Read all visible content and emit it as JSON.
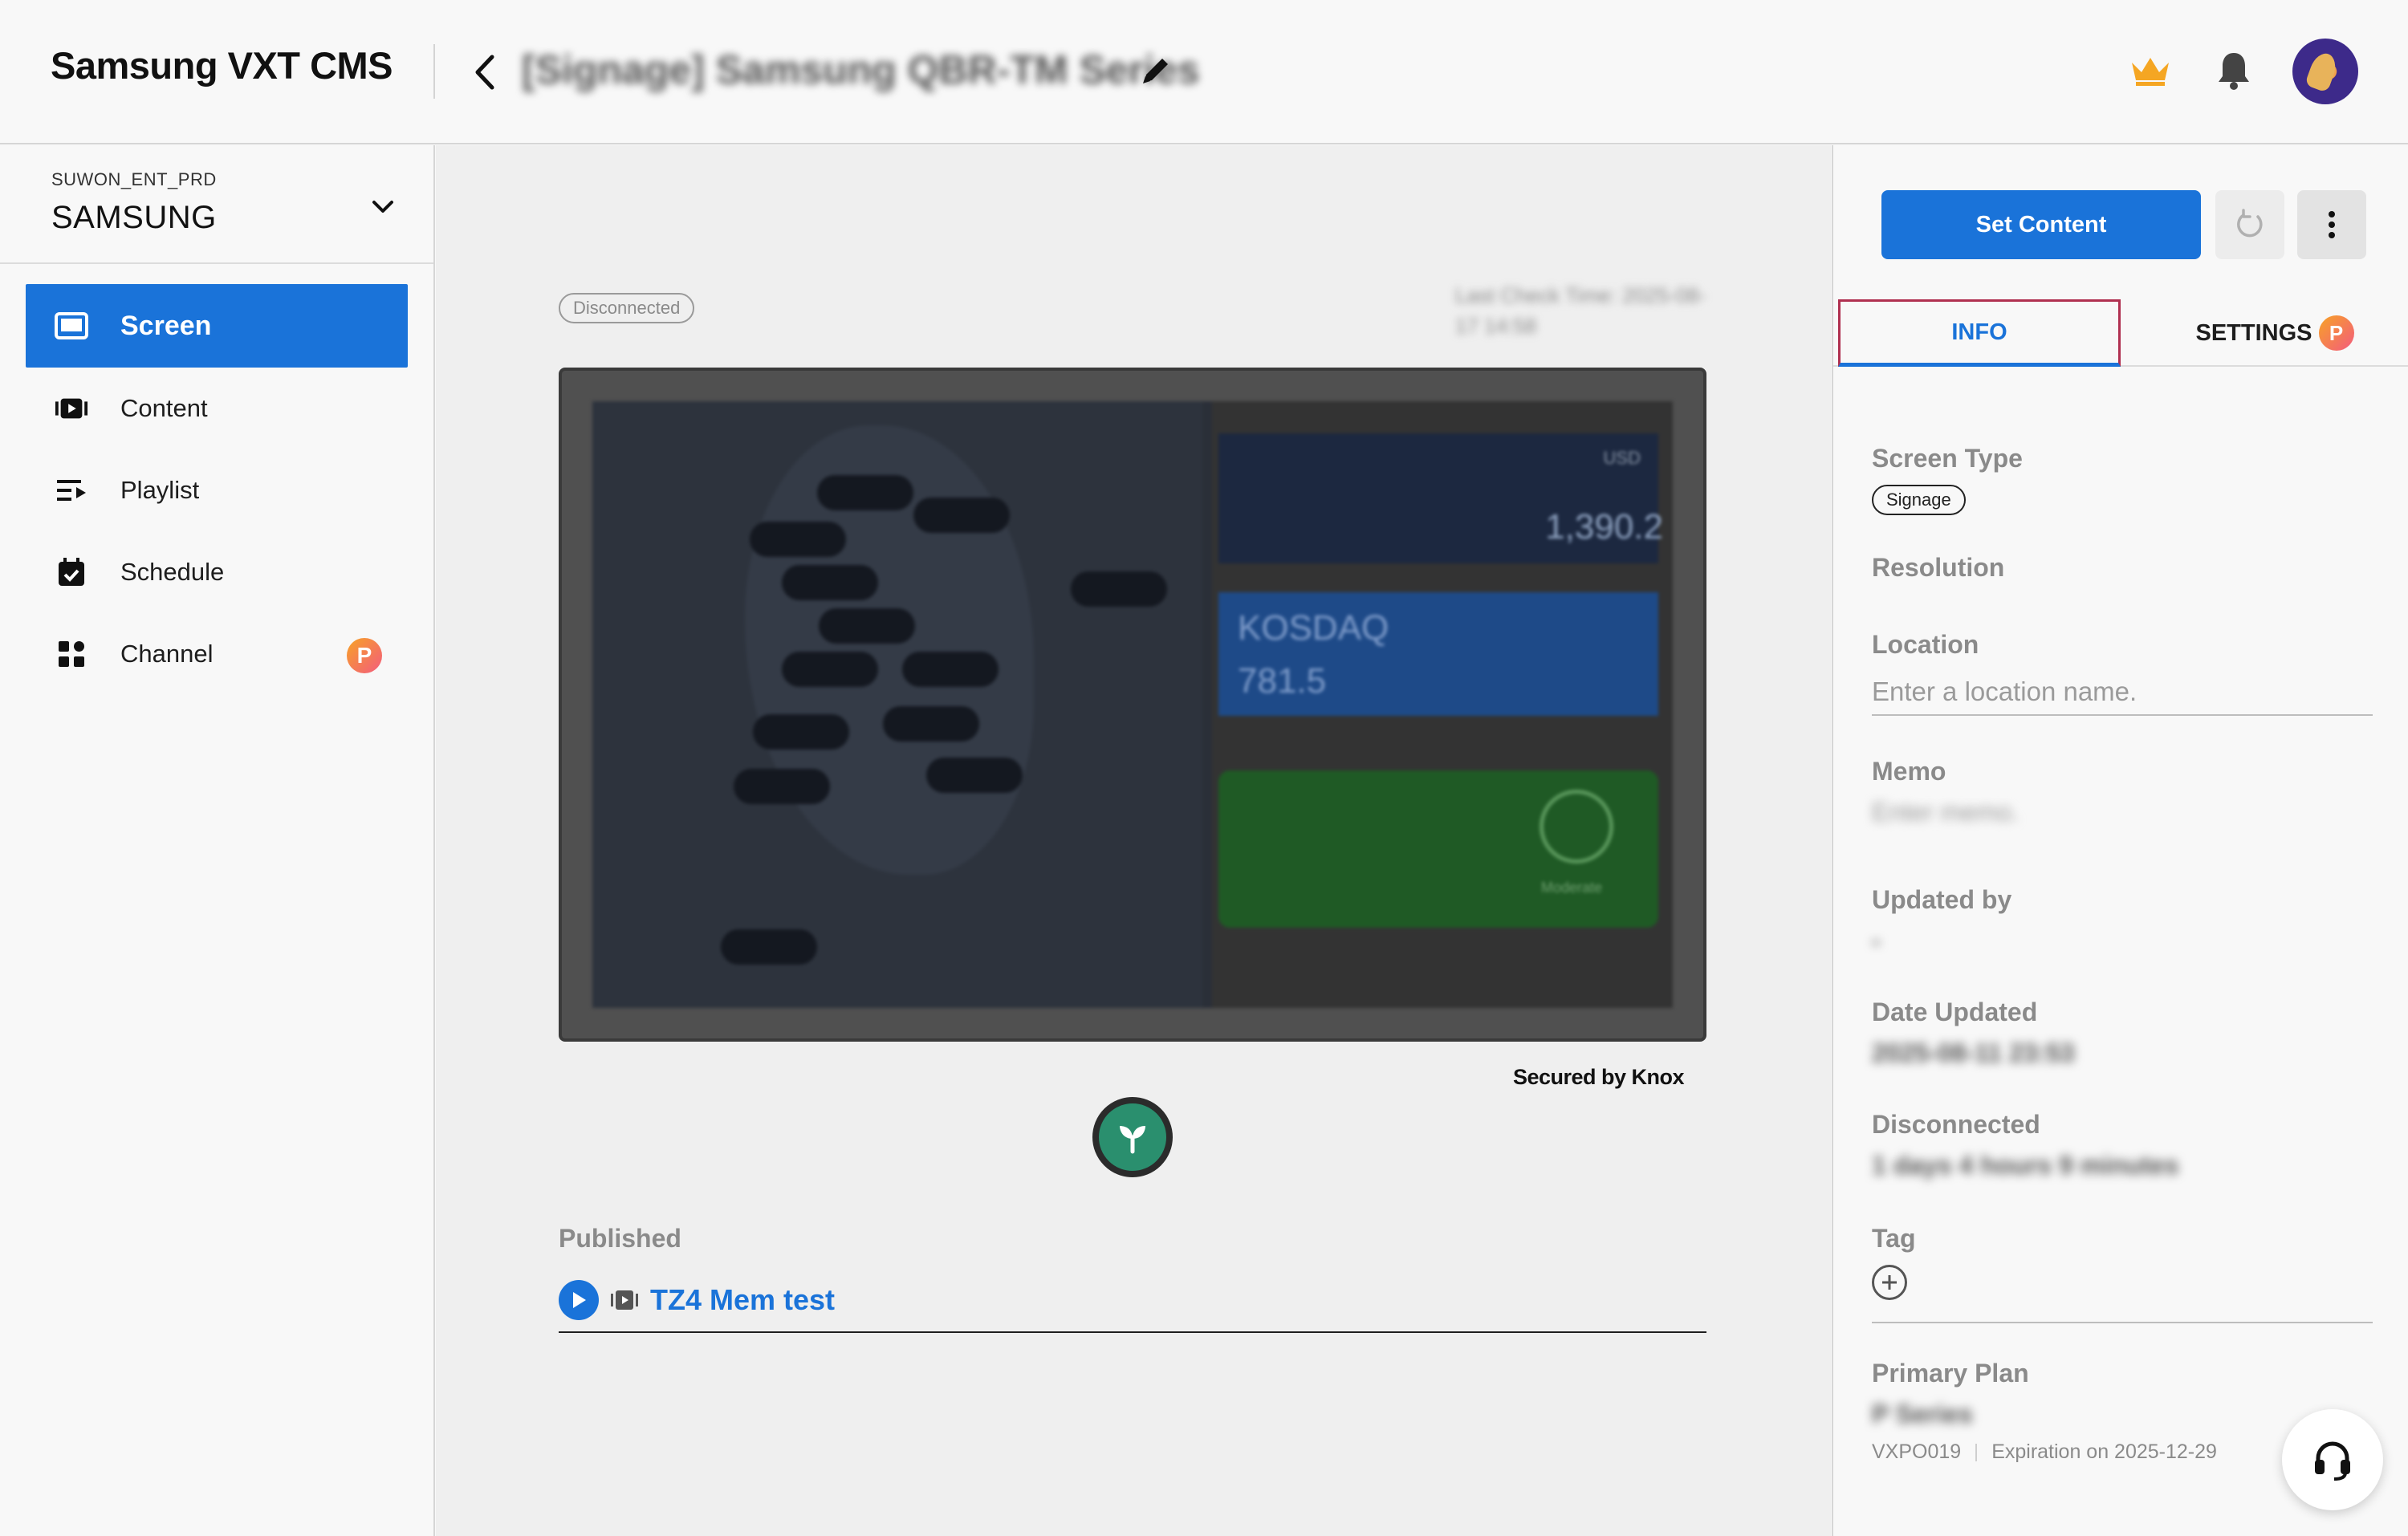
{
  "header": {
    "app_title": "Samsung VXT CMS",
    "device_title": "[Signage] Samsung QBR-TM Series"
  },
  "sidebar": {
    "org_code": "SUWON_ENT_PRD",
    "org_name": "SAMSUNG",
    "items": [
      {
        "label": "Screen",
        "icon": "screen-icon",
        "active": true
      },
      {
        "label": "Content",
        "icon": "content-icon"
      },
      {
        "label": "Playlist",
        "icon": "playlist-icon"
      },
      {
        "label": "Schedule",
        "icon": "schedule-icon"
      },
      {
        "label": "Channel",
        "icon": "channel-icon",
        "badge": "P"
      }
    ]
  },
  "main": {
    "status": "Disconnected",
    "last_check": "Last Check Time: 2025-08-17 14:58",
    "preview": {
      "usd_label": "USD",
      "usd_value": "1,390.2",
      "index_name": "KOSDAQ",
      "index_value": "781.5",
      "air_label": "Moderate"
    },
    "secured_text": "Secured by Knox",
    "published_label": "Published",
    "published_item": "TZ4 Mem test"
  },
  "right_panel": {
    "set_content": "Set Content",
    "tabs": {
      "info": "INFO",
      "settings": "SETTINGS",
      "settings_badge": "P"
    },
    "screen_type_label": "Screen Type",
    "screen_type_value": "Signage",
    "resolution_label": "Resolution",
    "location_label": "Location",
    "location_placeholder": "Enter a location name.",
    "memo_label": "Memo",
    "memo_placeholder": "Enter memo.",
    "updated_by_label": "Updated by",
    "updated_by_value": "-",
    "date_updated_label": "Date Updated",
    "date_updated_value": "2025-08-11 23:53",
    "disconnected_label": "Disconnected",
    "disconnected_value": "1 days 4 hours 9 minutes",
    "tag_label": "Tag",
    "primary_plan_label": "Primary Plan",
    "primary_plan_value": "P Series",
    "plan_code": "VXPO019",
    "plan_expiration": "Expiration on 2025-12-29"
  },
  "colors": {
    "accent": "#1a73d9",
    "badge_gradient_start": "#f7a326",
    "badge_gradient_end": "#f35b7e",
    "eco_green": "#2a8f6e"
  }
}
